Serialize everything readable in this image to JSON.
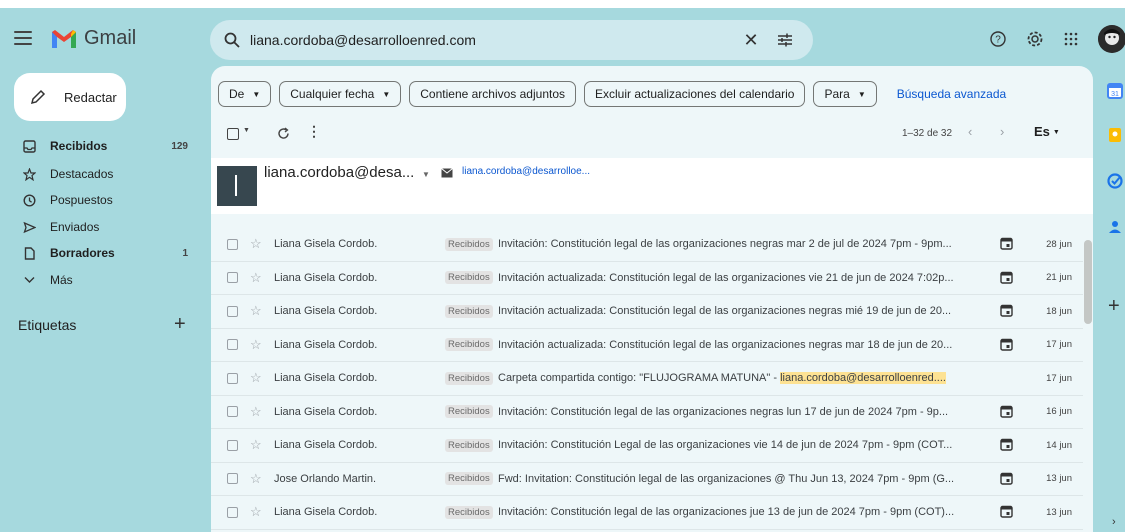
{
  "app": {
    "name": "Gmail"
  },
  "search": {
    "query": "liana.cordoba@desarrolloenred.com"
  },
  "sidebar": {
    "compose_label": "Redactar",
    "items": [
      {
        "label": "Recibidos",
        "count": "129",
        "icon": "inbox-icon",
        "bold": true
      },
      {
        "label": "Destacados",
        "count": "",
        "icon": "star-icon",
        "bold": false
      },
      {
        "label": "Pospuestos",
        "count": "",
        "icon": "clock-icon",
        "bold": false
      },
      {
        "label": "Enviados",
        "count": "",
        "icon": "send-icon",
        "bold": false
      },
      {
        "label": "Borradores",
        "count": "1",
        "icon": "draft-icon",
        "bold": true
      },
      {
        "label": "Más",
        "count": "",
        "icon": "chevron-down-icon",
        "bold": false
      }
    ],
    "labels_title": "Etiquetas"
  },
  "filters": {
    "from": "De",
    "any_date": "Cualquier fecha",
    "has_attachments": "Contiene archivos adjuntos",
    "exclude_calendar": "Excluir actualizaciones del calendario",
    "to": "Para",
    "advanced": "Búsqueda avanzada"
  },
  "toolbar": {
    "range": "1–32 de 32",
    "lang": "Es"
  },
  "contact": {
    "name": "liana.cordoba@desa...",
    "email": "liana.cordoba@desarrolloe..."
  },
  "emails": [
    {
      "sender": "Liana Gisela Cordob.",
      "tag": "Recibidos",
      "subject": "Invitación: Constitución legal de las organizaciones negras mar 2 de jul de 2024 7pm - 9pm...",
      "highlight": "",
      "date": "28 jun",
      "calendar": true
    },
    {
      "sender": "Liana Gisela Cordob.",
      "tag": "Recibidos",
      "subject": "Invitación actualizada: Constitución legal de las organizaciones vie 21 de jun de 2024 7:02p...",
      "highlight": "",
      "date": "21 jun",
      "calendar": true
    },
    {
      "sender": "Liana Gisela Cordob.",
      "tag": "Recibidos",
      "subject": "Invitación actualizada: Constitución legal de las organizaciones negras mié 19 de jun de 20...",
      "highlight": "",
      "date": "18 jun",
      "calendar": true
    },
    {
      "sender": "Liana Gisela Cordob.",
      "tag": "Recibidos",
      "subject": "Invitación actualizada: Constitución legal de las organizaciones negras mar 18 de jun de 20...",
      "highlight": "",
      "date": "17 jun",
      "calendar": true
    },
    {
      "sender": "Liana Gisela Cordob.",
      "tag": "Recibidos",
      "subject": "Carpeta compartida contigo: \"FLUJOGRAMA MATUNA\" - ",
      "highlight": "liana.cordoba@desarrolloenred....",
      "date": "17 jun",
      "calendar": false
    },
    {
      "sender": "Liana Gisela Cordob.",
      "tag": "Recibidos",
      "subject": "Invitación: Constitución legal de las organizaciones negras lun 17 de jun de 2024 7pm - 9p...",
      "highlight": "",
      "date": "16 jun",
      "calendar": true
    },
    {
      "sender": "Liana Gisela Cordob.",
      "tag": "Recibidos",
      "subject": "Invitación: Constitución Legal de las organizaciones vie 14 de jun de 2024 7pm - 9pm (COT...",
      "highlight": "",
      "date": "14 jun",
      "calendar": true
    },
    {
      "sender": "Jose Orlando Martin.",
      "tag": "Recibidos",
      "subject": "Fwd: Invitation: Constitución legal de las organizaciones @ Thu Jun 13, 2024 7pm - 9pm (G...",
      "highlight": "",
      "date": "13 jun",
      "calendar": true
    },
    {
      "sender": "Liana Gisela Cordob.",
      "tag": "Recibidos",
      "subject": "Invitación: Constitución legal de las organizaciones jue 13 de jun de 2024 7pm - 9pm (COT)...",
      "highlight": "",
      "date": "13 jun",
      "calendar": true
    }
  ],
  "right_panel": [
    {
      "icon": "calendar-icon",
      "color": "#4285f4"
    },
    {
      "icon": "keep-icon",
      "color": "#fbbc04"
    },
    {
      "icon": "tasks-icon",
      "color": "#1a73e8"
    },
    {
      "icon": "contacts-icon",
      "color": "#1a73e8"
    }
  ],
  "colors": {
    "background": "#a6d9de",
    "panel": "#eef7f9",
    "link": "#0b57d0",
    "highlight": "#fde293"
  }
}
